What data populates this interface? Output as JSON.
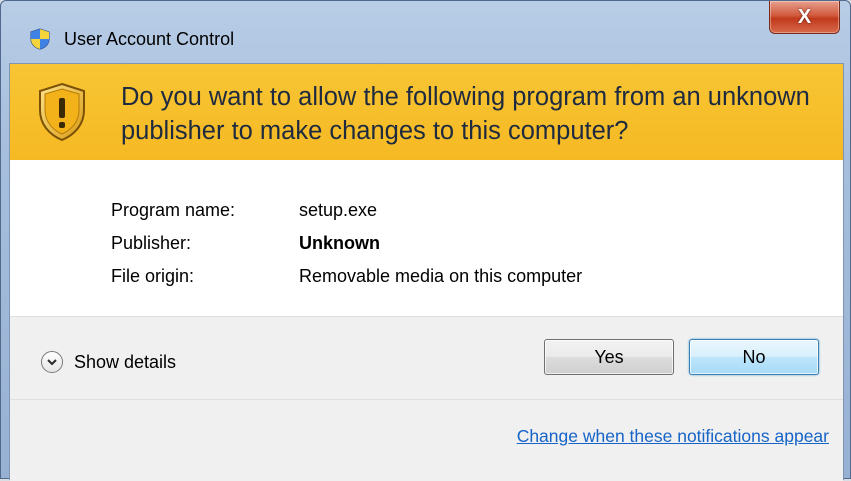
{
  "window": {
    "title": "User Account Control",
    "close_glyph": "X"
  },
  "banner": {
    "question": "Do you want to allow the following program from an unknown publisher to make changes to this computer?",
    "icon": "warning-shield-icon",
    "color": "#f8c534"
  },
  "info": {
    "rows": [
      {
        "label": "Program name:",
        "value": "setup.exe"
      },
      {
        "label": "Publisher:",
        "value": "Unknown"
      },
      {
        "label": "File origin:",
        "value": "Removable media on this computer"
      }
    ]
  },
  "footer": {
    "details_label": "Show details",
    "yes_label": "Yes",
    "no_label": "No",
    "link_text": "Change when these notifications appear"
  },
  "colors": {
    "link": "#1664c8",
    "default_button": "#3c7fb1",
    "close_button": "#c13a1c"
  }
}
